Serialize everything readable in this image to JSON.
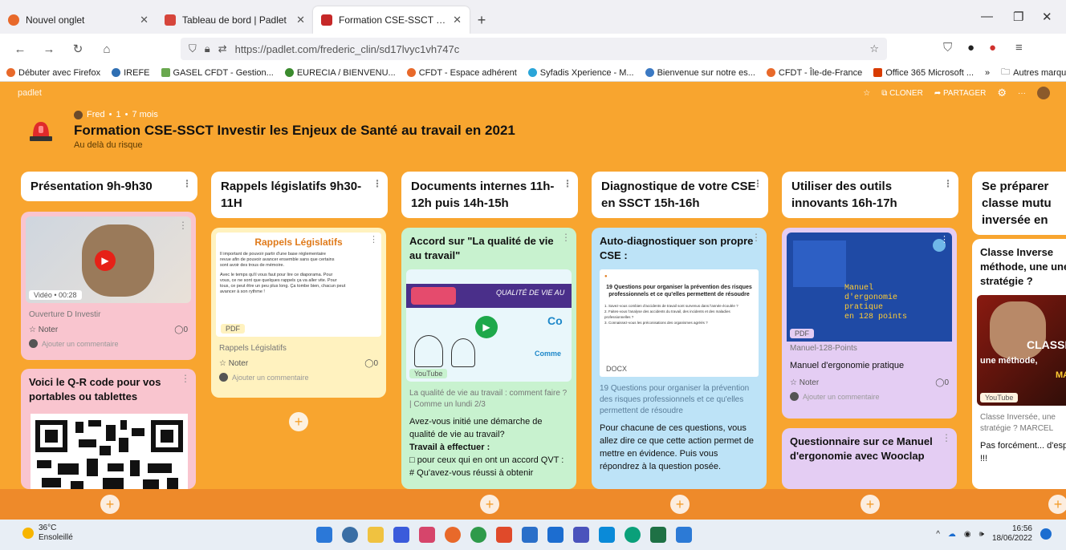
{
  "browser": {
    "tabs": [
      {
        "label": "Nouvel onglet",
        "favicon_color": "#e8692a"
      },
      {
        "label": "Tableau de bord | Padlet",
        "favicon_color": "#d6453b"
      },
      {
        "label": "Formation CSE-SSCT Investir les",
        "favicon_color": "#c62828",
        "active": true
      }
    ],
    "new_tab": "+",
    "url": "https://padlet.com/frederic_clin/sd17lvyc1vh747c",
    "url_domain": "padlet.com",
    "bookmarks": [
      {
        "label": "Débuter avec Firefox",
        "color": "#e8692a"
      },
      {
        "label": "IREFE",
        "color": "#2f6fb3"
      },
      {
        "label": "GASEL CFDT - Gestion...",
        "color": "#6aa84f"
      },
      {
        "label": "EURECIA / BIENVENU...",
        "color": "#3b8b2e"
      },
      {
        "label": "CFDT - Espace adhérent",
        "color": "#e8692a"
      },
      {
        "label": "Syfadis Xperience - M...",
        "color": "#2aa5d8"
      },
      {
        "label": "Bienvenue sur notre es...",
        "color": "#3b79c3"
      },
      {
        "label": "CFDT - Île-de-France",
        "color": "#e8692a"
      },
      {
        "label": "Office 365 Microsoft ...",
        "color": "#d83b01"
      }
    ],
    "other_bookmarks": "Autres marque-pages",
    "overflow": "»"
  },
  "padlet": {
    "brand": "padlet",
    "actions": {
      "clone": "CLONER",
      "share": "PARTAGER",
      "more": "···"
    },
    "meta": {
      "author": "Fred",
      "separator1": "•",
      "count": "1",
      "separator2": "•",
      "age": "7 mois"
    },
    "title": "Formation CSE-SSCT Investir les Enjeux de Santé au travail en 2021",
    "subtitle": "Au delà du risque",
    "columns": [
      {
        "header": "Présentation 9h-9h30",
        "cards": [
          {
            "badge": "Vidéo • 00:28",
            "caption": "Ouverture D Investir",
            "like": "Noter",
            "comments": "0",
            "comment_placeholder": "Ajouter un commentaire",
            "color": "#f9c5cf"
          },
          {
            "title": "Voici le Q-R code pour vos portables ou tablettes",
            "color": "#f9c5cf"
          }
        ]
      },
      {
        "header": "Rappels législatifs 9h30-11H",
        "cards": [
          {
            "doc_title": "Rappels Législatifs",
            "doc_lines": [
              "Il important de pouvoir partir d'une base réglementaire",
              "revue afin de pouvoir avancer ensemble sans que certains",
              "sont avoir des trous de mémoire.",
              "Avec le temps qu'il vous faut pour lire ce diaporama. Pour",
              "vous, ce ne sont que quelques rappels ça va aller vite. Pour",
              "tous, ce peut être un peu plus long. Ça tombe bien, chacun peut",
              "avancer à son rythme !"
            ],
            "badge": "PDF",
            "caption": "Rappels Législatifs",
            "like": "Noter",
            "comments": "0",
            "comment_placeholder": "Ajouter un commentaire",
            "color": "#fff2bf"
          }
        ]
      },
      {
        "header": "Documents internes 11h-12h puis 14h-15h",
        "cards": [
          {
            "title": "Accord sur \"La qualité de vie au travail\"",
            "thumb_text": "QUALITÉ DE VIE AU",
            "thumb_text2": "Co",
            "thumb_text3": "Comme",
            "badge": "YouTube",
            "caption": "La qualité de vie au travail : comment faire ? | Comme un lundi 2/3",
            "body": [
              "Avez-vous initié une démarche de qualité de vie au travail?",
              "Travail à effectuer :",
              "□ pour ceux qui en ont un accord QVT :",
              "# Qu'avez-vous réussi à obtenir"
            ],
            "color": "#c8f2cf"
          }
        ]
      },
      {
        "header": "Diagnostique de votre CSE en SSCT 15h-16h",
        "cards": [
          {
            "title": "Auto-diagnostiquer son propre CSE :",
            "doc_title": "19 Questions pour organiser la prévention des risques professionnels et ce qu'elles permettent de résoudre",
            "doc_lines": [
              "1. Savez-vous combien d'accidents de travail sont survenus dans l'année écoulée ?",
              "2. Faites-vous l'analyse des accidents du travail, des incidents et des maladies professionnelles ?",
              "3. Connaissez-vous les préconisations des organismes agréés ?"
            ],
            "badge": "DOCX",
            "caption": "19 Questions pour organiser la prévention des risques professionnels et ce qu'elles permettent de résoudre",
            "body": [
              "Pour chacune de ces questions, vous allez dire ce que cette action permet de mettre en évidence. Puis vous répondrez à la question posée."
            ],
            "color": "#bde3f7"
          }
        ]
      },
      {
        "header": "Utiliser des outils innovants 16h-17h",
        "cards": [
          {
            "thumb_lines": [
              "Manuel",
              "d'ergonomie",
              "pratique",
              "en 128 points"
            ],
            "badge": "PDF",
            "caption": "Manuel-128-Points",
            "subtitle": "Manuel d'ergonomie pratique",
            "like": "Noter",
            "comments": "0",
            "comment_placeholder": "Ajouter un commentaire",
            "color": "#e4cdf3"
          },
          {
            "title": "Questionnaire sur ce Manuel d'ergonomie avec Wooclap",
            "color": "#e4cdf3"
          }
        ]
      },
      {
        "header": "Se préparer classe mutu inversée en",
        "cards": [
          {
            "title": "Classe Inverse méthode, une une stratégie ?",
            "thumb_text": "CLASSE",
            "thumb_text2": "une méthode,",
            "thumb_text3": "MAI",
            "badge": "YouTube",
            "caption": "Classe Inversée, une stratégie ? MARCEL",
            "body": [
              "Pas forcément... d'esprit !!!"
            ],
            "color": "#ffffff"
          }
        ]
      }
    ],
    "add_post": "+"
  },
  "taskbar": {
    "weather_temp": "36°C",
    "weather_desc": "Ensoleillé",
    "time": "16:56",
    "date": "18/06/2022",
    "tray_overflow": "^"
  }
}
